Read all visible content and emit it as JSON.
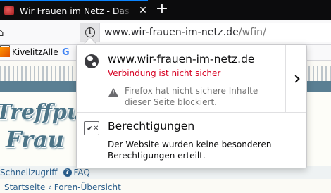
{
  "tab": {
    "title": "Wir Frauen im Netz - Das Frauen",
    "close_glyph": "✕",
    "new_tab_glyph": "+"
  },
  "urlbar": {
    "domain": "www.wir-frauen-im-netz.de",
    "path": "/wfin/"
  },
  "bookmarks": {
    "kivelitz_label": "KivelitzAlle",
    "google_glyph": "G"
  },
  "page": {
    "brand_line1": "Treffpunkt",
    "brand_line2": "Frau",
    "quicklink_label": "Schnellzugriff",
    "faq_label": "FAQ",
    "faq_glyph": "?",
    "breadcrumb": "Startseite ‹ Foren-Übersicht"
  },
  "popup": {
    "site_name": "www.wir-frauen-im-netz.de",
    "connection_status": "Verbindung ist nicht sicher",
    "blocked_message": "Firefox hat nicht sichere Inhalte dieser Seite blockiert.",
    "permissions_title": "Berechtigungen",
    "permissions_desc": "Der Website wurden keine besonderen Berechtigungen erteilt.",
    "status_color": "#d70022"
  }
}
